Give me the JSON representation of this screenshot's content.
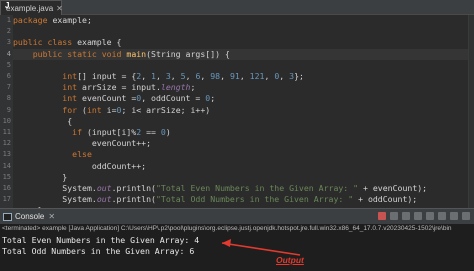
{
  "editor": {
    "tab_label": "example.java",
    "tab_close": "✕",
    "line_numbers": [
      "1",
      "2",
      "3",
      "4",
      "5",
      "6",
      "7",
      "8",
      "9",
      "10",
      "11",
      "12",
      "13",
      "14",
      "15",
      "16",
      "17"
    ],
    "lines": {
      "l1": [
        "package example;"
      ],
      "l3": [
        "public class example {"
      ],
      "l4": [
        "    public static void main(String args[]) {"
      ],
      "l6": [
        "int",
        "[] input = {",
        "2",
        ", ",
        "1",
        ", ",
        "3",
        ", ",
        "5",
        ", ",
        "6",
        ", ",
        "98",
        ", ",
        "91",
        ", ",
        "121",
        ", ",
        "0",
        ", ",
        "3",
        "};"
      ],
      "l7": [
        "int",
        " arrSize = input.",
        "length",
        ";"
      ],
      "l8": [
        "int",
        " evenCount =",
        "0",
        ", oddCount = ",
        "0",
        ";"
      ],
      "l9": [
        "for",
        " (",
        "int",
        " i=",
        "0",
        "; i< arrSize; i++)"
      ],
      "l10": [
        "{"
      ],
      "l11": [
        "if",
        " (input[i]%",
        "2",
        " == ",
        "0",
        ")"
      ],
      "l12": [
        "evenCount++;"
      ],
      "l13": [
        "else"
      ],
      "l14": [
        "oddCount++;"
      ],
      "l15": [
        "}"
      ],
      "l16": [
        "System.",
        "out",
        ".println(",
        "\"Total Even Numbers in the Given Array: \"",
        " + evenCount);"
      ],
      "l17": [
        "System.",
        "out",
        ".println(",
        "\"Total Odd Numbers in the Given Array: \"",
        " + oddCount);"
      ],
      "l18": [
        "}"
      ]
    }
  },
  "console": {
    "title": "Console",
    "close": "✕",
    "terminated": "<terminated> example [Java Application] C:\\Users\\HP\\.p2\\pool\\plugins\\org.eclipse.justj.openjdk.hotspot.jre.full.win32.x86_64_17.0.7.v20230425-1502\\jre\\bin",
    "output": [
      "Total Even Numbers in the Given Array: 4",
      "Total Odd Numbers in the Given Array: 6"
    ],
    "annotation": "Output"
  },
  "colors": {
    "keyword": "#cc7832",
    "string": "#6a8759",
    "number": "#6897bb",
    "annotation": "#e23a2e"
  }
}
